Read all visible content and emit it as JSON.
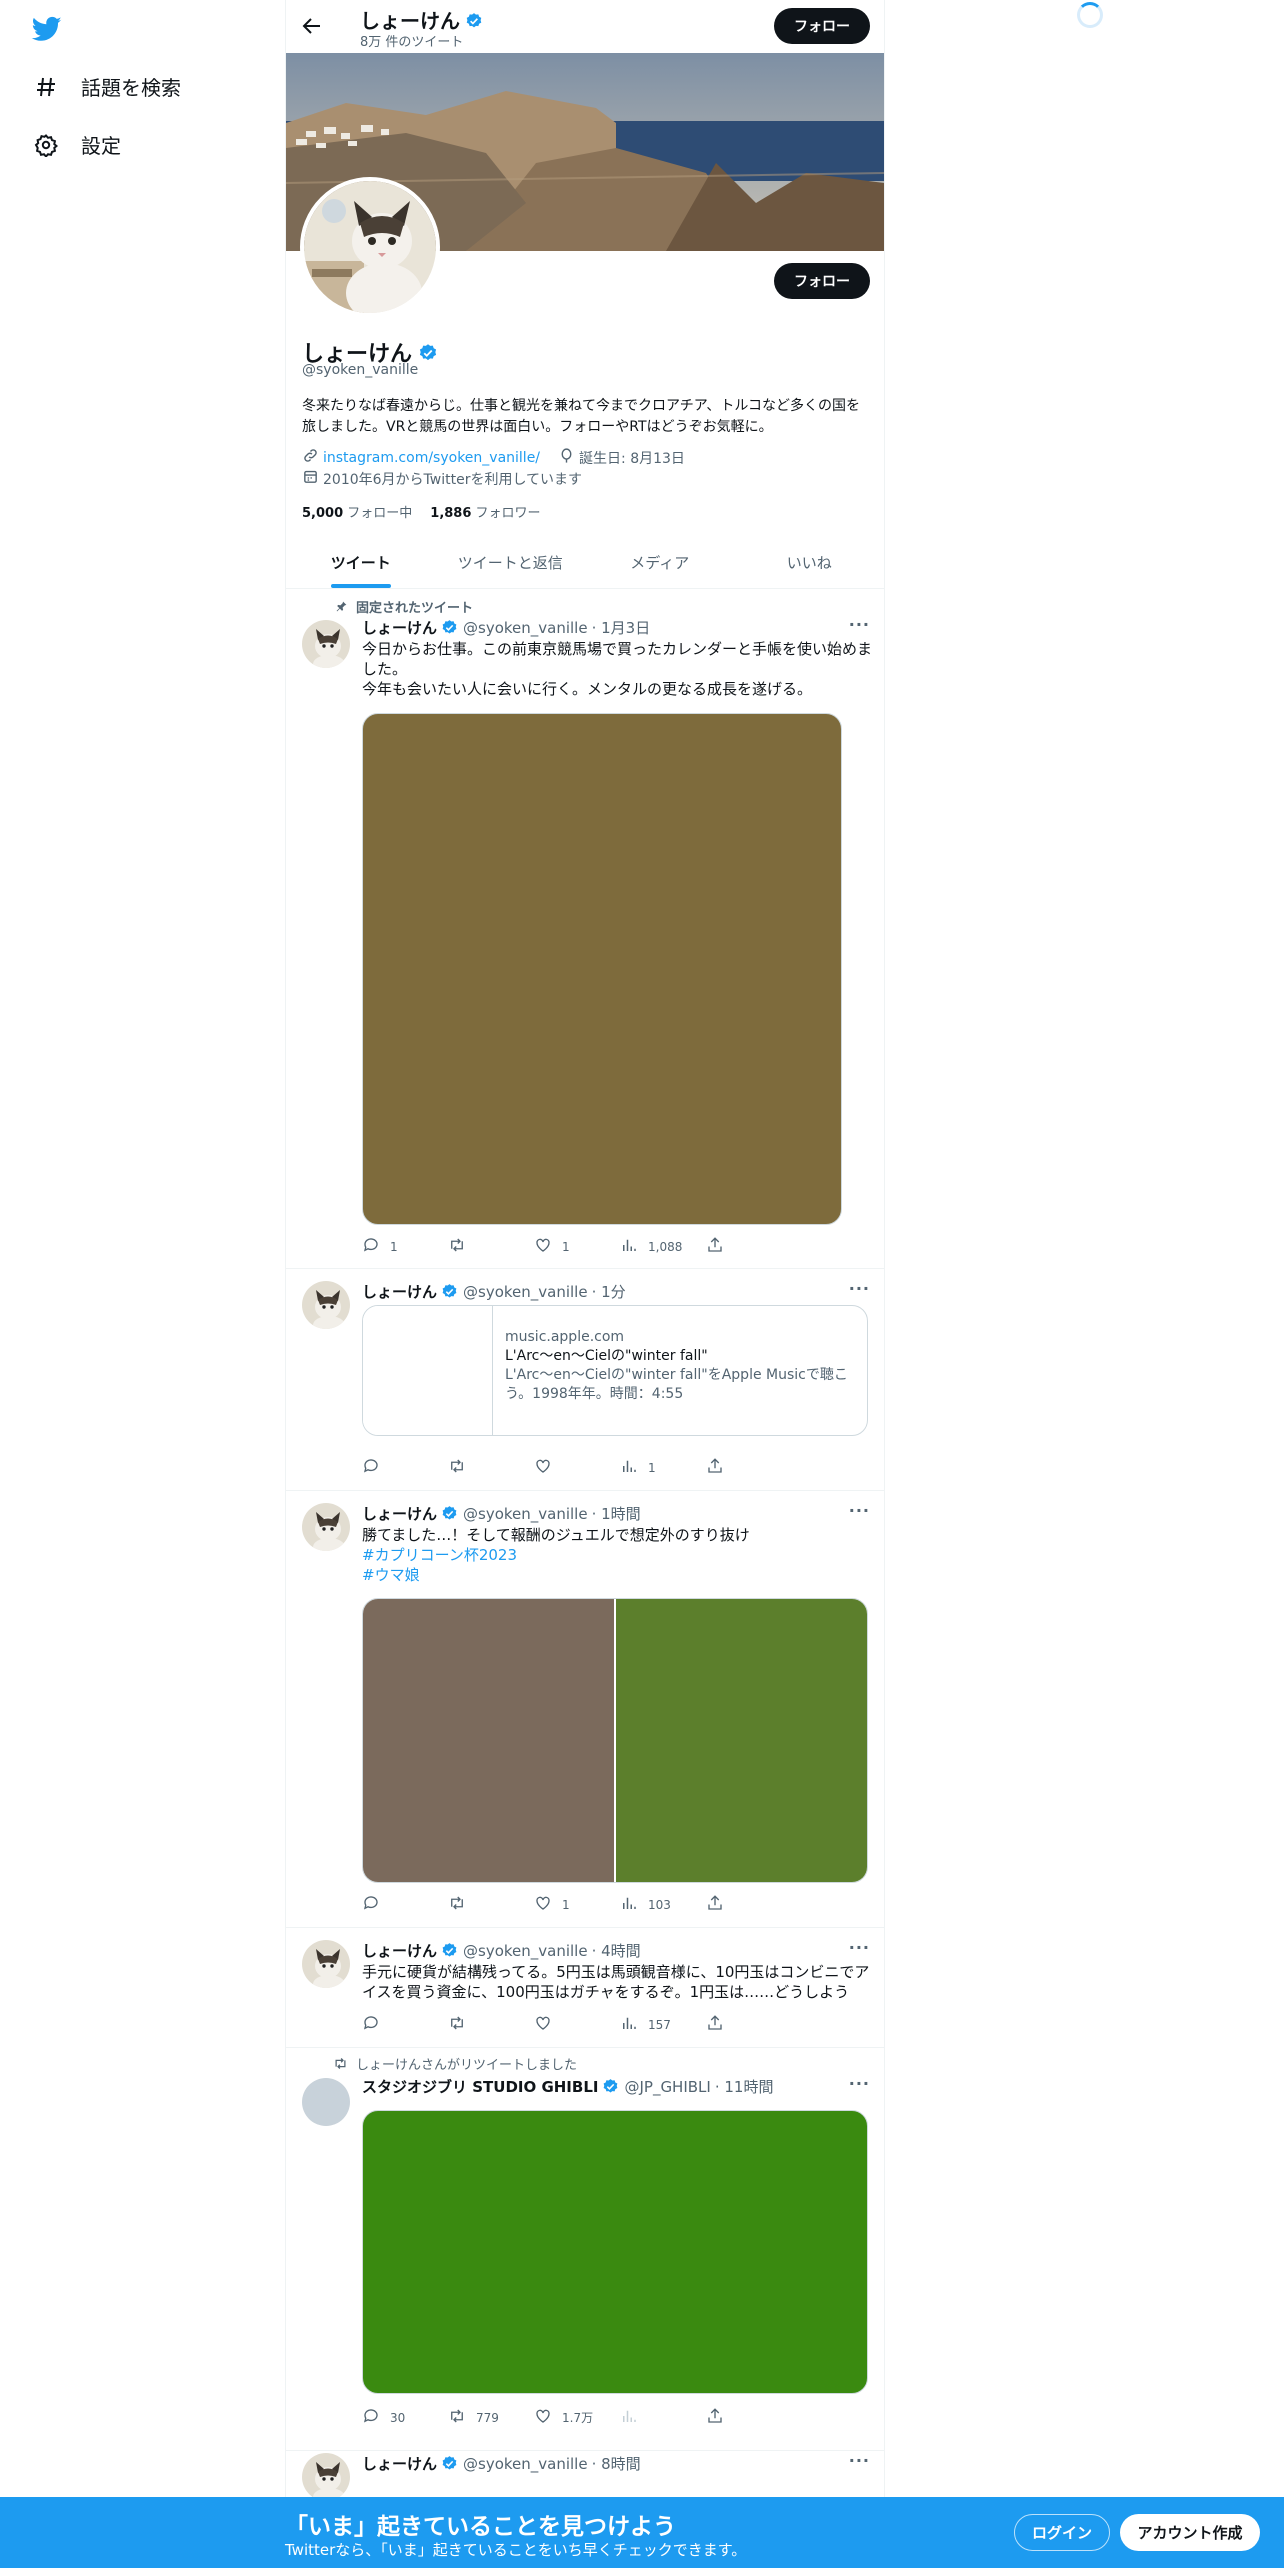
{
  "nav": {
    "explore_label": "話題を検索",
    "settings_label": "設定"
  },
  "header": {
    "name": "しょーけん",
    "tweet_count": "8万 件のツイート",
    "follow_label": "フォロー"
  },
  "profile": {
    "name": "しょーけん",
    "handle": "@syoken_vanille",
    "follow_label": "フォロー",
    "bio": "冬来たりなば春遠からじ。仕事と観光を兼ねて今までクロアチア、トルコなど多くの国を旅しました。VRと競馬の世界は面白い。フォローやRTはどうぞお気軽に。",
    "link": "instagram.com/syoken_vanille/",
    "birthday": "誕生日: 8月13日",
    "joined": "2010年6月からTwitterを利用しています",
    "following_count": "5,000",
    "following_label": "フォロー中",
    "followers_count": "1,886",
    "followers_label": "フォロワー"
  },
  "tabs": [
    "ツイート",
    "ツイートと返信",
    "メディア",
    "いいね"
  ],
  "tweets": [
    {
      "context": "固定されたツイート",
      "name": "しょーけん",
      "handle": "@syoken_vanille",
      "time": "· 1月3日",
      "text1": "今日からお仕事。この前東京競馬場で買ったカレンダーと手帳を使い始めました。",
      "text2": "今年も会いたい人に会いに行く。メンタルの更なる成長を遂げる。",
      "media_color": "#7e6b3c",
      "replies": "1",
      "retweets": "",
      "likes": "1",
      "views": "1,088"
    },
    {
      "name": "しょーけん",
      "handle": "@syoken_vanille",
      "time": "· 1分",
      "card_domain": "music.apple.com",
      "card_title": "L'Arc〜en〜Cielの\"winter fall\"",
      "card_desc": "L'Arc〜en〜Cielの\"winter fall\"をApple Musicで聴こう。1998年年。時間：4:55",
      "replies": "",
      "retweets": "",
      "likes": "",
      "views": "1"
    },
    {
      "name": "しょーけん",
      "handle": "@syoken_vanille",
      "time": "· 1時間",
      "text1": "勝てました…！そして報酬のジュエルで想定外のすり抜け",
      "tag1": "#カプリコーン杯2023",
      "tag2": "#ウマ娘",
      "media_color_left": "#7b6a5c",
      "media_color_right": "#5c7f2c",
      "replies": "",
      "retweets": "",
      "likes": "1",
      "views": "103"
    },
    {
      "name": "しょーけん",
      "handle": "@syoken_vanille",
      "time": "· 4時間",
      "text1": "手元に硬貨が結構残ってる。5円玉は馬頭観音様に、10円玉はコンビニでアイスを買う資金に、100円玉はガチャをするぞ。1円玉は……どうしよう",
      "replies": "",
      "retweets": "",
      "likes": "",
      "views": "157"
    },
    {
      "context": "しょーけんさんがリツイートしました",
      "name": "スタジオジブリ STUDIO GHIBLI",
      "handle": "@JP_GHIBLI",
      "time": "· 11時間",
      "media_color": "#3a8a10",
      "replies": "30",
      "retweets": "779",
      "likes": "1.7万",
      "views": ""
    },
    {
      "name": "しょーけん",
      "handle": "@syoken_vanille",
      "time": "· 8時間"
    }
  ],
  "bottom_bar": {
    "title": "「いま」起きていることを見つけよう",
    "subtitle": "Twitterなら、「いま」起きていることをいち早くチェックできます。",
    "login_label": "ログイン",
    "signup_label": "アカウント作成"
  },
  "colors": {
    "accent": "#1d9bf0",
    "text": "#0f1419",
    "muted": "#536471"
  }
}
